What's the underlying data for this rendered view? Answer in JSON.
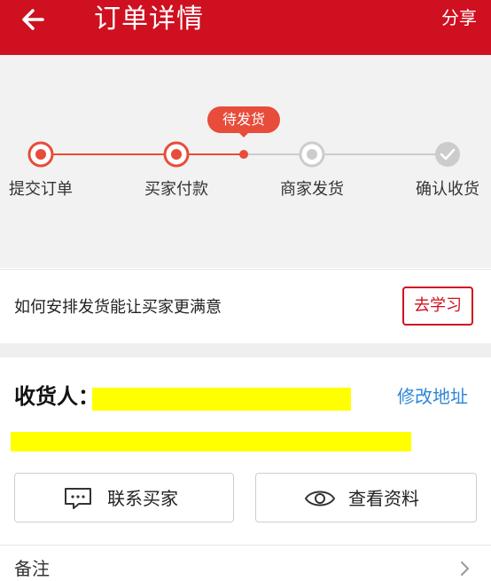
{
  "header": {
    "title": "订单详情",
    "share_label": "分享",
    "bg_color": "#cf1020"
  },
  "progress": {
    "current_badge": "待发货",
    "steps": [
      {
        "label": "提交订单",
        "state": "done"
      },
      {
        "label": "买家付款",
        "state": "done"
      },
      {
        "label": "商家发货",
        "state": "pending"
      },
      {
        "label": "确认收货",
        "state": "pending"
      }
    ],
    "active_color": "#e84c3a",
    "inactive_color": "#cccccc"
  },
  "tip": {
    "text": "如何安排发货能让买家更满意",
    "button_label": "去学习"
  },
  "address": {
    "recipient_label": "收货人：",
    "modify_label": "修改地址",
    "contact_button": "联系买家",
    "profile_button": "查看资料",
    "remark_label": "备注"
  }
}
